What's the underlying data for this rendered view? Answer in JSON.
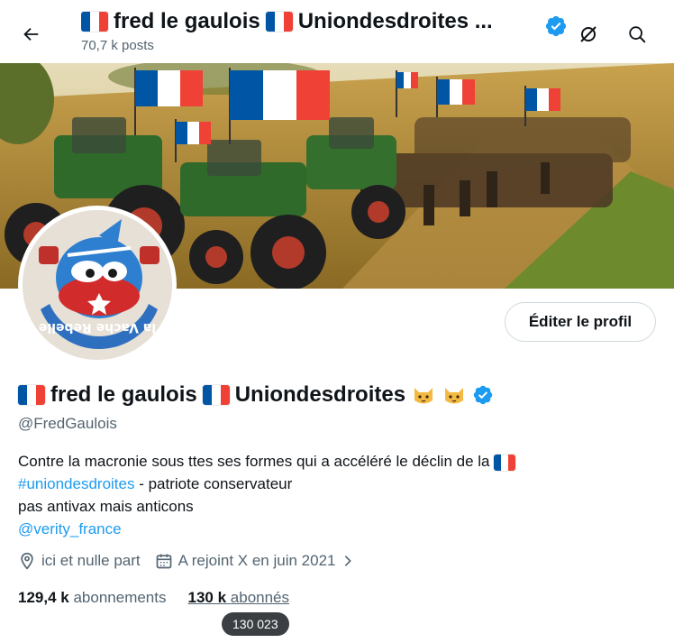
{
  "header": {
    "title_name": "fred le gaulois",
    "title_suffix": "Uniondesdroites ...",
    "post_count": "70,7 k posts"
  },
  "profile": {
    "display_name_part1": "fred le gaulois",
    "display_name_part2": "Uniondesdroites",
    "handle": "@FredGaulois",
    "edit_button_label": "Éditer le profil",
    "avatar_text": "la Vache Rebelle"
  },
  "bio": {
    "line1": "Contre la macronie sous ttes ses formes qui a accéléré le déclin de la",
    "hashtag": "#uniondesdroites",
    "line2_rest": " - patriote conservateur",
    "line3": "pas antivax mais anticons",
    "mention": "@verity_france"
  },
  "meta": {
    "location": "ici et nulle part",
    "joined": "A rejoint X en juin 2021"
  },
  "stats": {
    "following_count": "129,4 k",
    "following_label": "abonnements",
    "followers_count": "130 k",
    "followers_label": "abonnés"
  },
  "tooltip": {
    "text": "130 023"
  },
  "colors": {
    "accent": "#1d9bf0",
    "flag_blue": "#0055a4",
    "flag_white": "#ffffff",
    "flag_red": "#ef4135",
    "secondary_text": "#536471"
  },
  "icons": [
    "back-arrow-icon",
    "verified-badge-icon",
    "grok-icon",
    "search-icon",
    "location-icon",
    "calendar-icon",
    "chevron-right-icon",
    "cat-emoji-icon"
  ]
}
